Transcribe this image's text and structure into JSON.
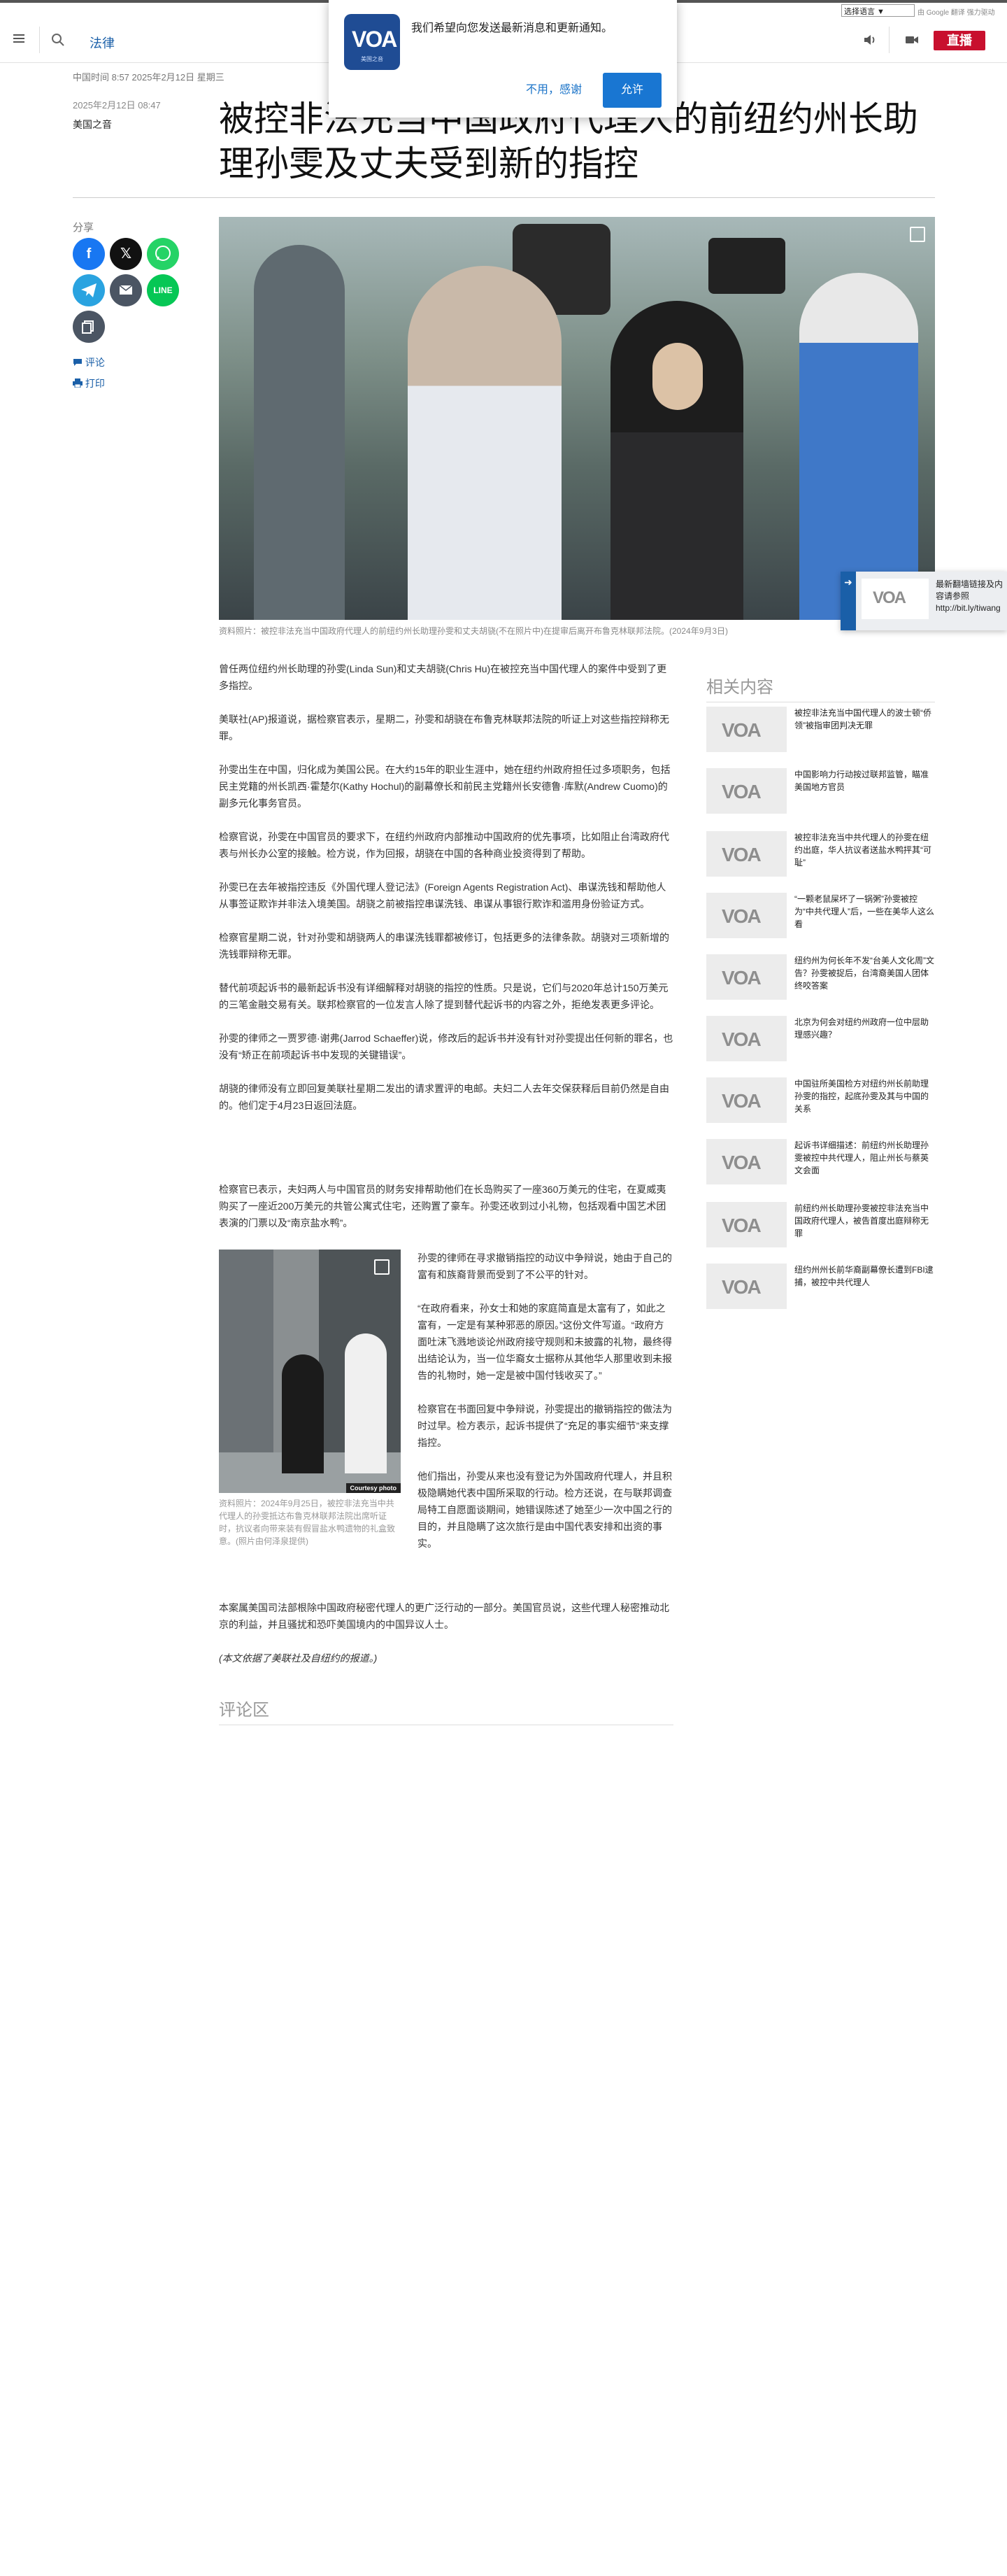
{
  "topbar": {
    "language_select": "选择语言 ▼",
    "google_translate": "由 Google 翻译 强力驱动"
  },
  "header": {
    "section": "法律",
    "live_label": "直播"
  },
  "notification": {
    "message": "我们希望向您发送最新消息和更新通知。",
    "logo_text": "VOA",
    "logo_sub": "美国之音",
    "deny_label": "不用，感谢",
    "allow_label": "允许"
  },
  "article": {
    "dateline": "中国时间 8:57 2025年2月12日 星期三",
    "published": "2025年2月12日 08:47",
    "byline": "美国之音",
    "title": "被控非法充当中国政府代理人的前纽约州长助理孙雯及丈夫受到新的指控",
    "share_label": "分享",
    "comment_link": "评论",
    "print_link": "打印",
    "hero_caption": "资料照片：被控非法充当中国政府代理人的前纽约州长助理孙雯和丈夫胡骁(不在照片中)在提审后离开布鲁克林联邦法院。(2024年9月3日)",
    "paragraphs": [
      "曾任两位纽约州长助理的孙雯(Linda Sun)和丈夫胡骁(Chris Hu)在被控充当中国代理人的案件中受到了更多指控。",
      "美联社(AP)报道说，据检察官表示，星期二，孙雯和胡骁在布鲁克林联邦法院的听证上对这些指控辩称无罪。",
      "孙雯出生在中国，归化成为美国公民。在大约15年的职业生涯中，她在纽约州政府担任过多项职务，包括民主党籍的州长凯西·霍楚尔(Kathy Hochul)的副幕僚长和前民主党籍州长安德鲁·库默(Andrew Cuomo)的副多元化事务官员。",
      "检察官说，孙雯在中国官员的要求下，在纽约州政府内部推动中国政府的优先事项，比如阻止台湾政府代表与州长办公室的接触。检方说，作为回报，胡骁在中国的各种商业投资得到了帮助。",
      "孙雯已在去年被指控违反《外国代理人登记法》(Foreign Agents Registration Act)、串谋洗钱和帮助他人从事签证欺诈并非法入境美国。胡骁之前被指控串谋洗钱、串谋从事银行欺诈和滥用身份验证方式。",
      "检察官星期二说，针对孙雯和胡骁两人的串谋洗钱罪都被修订，包括更多的法律条款。胡骁对三项新增的洗钱罪辩称无罪。",
      "替代前项起诉书的最新起诉书没有详细解释对胡骁的指控的性质。只是说，它们与2020年总计150万美元的三笔金融交易有关。联邦检察官的一位发言人除了提到替代起诉书的内容之外，拒绝发表更多评论。",
      "孙雯的律师之一贾罗德·谢弗(Jarrod Schaeffer)说，修改后的起诉书并没有针对孙雯提出任何新的罪名，也没有“矫正在前项起诉书中发现的关键错误”。",
      "胡骁的律师没有立即回复美联社星期二发出的请求置评的电邮。夫妇二人去年交保获释后目前仍然是自由的。他们定于4月23日返回法庭。"
    ],
    "paragraph_ten": "检察官已表示，夫妇两人与中国官员的财务安排帮助他们在长岛购买了一座360万美元的住宅，在夏威夷购买了一座近200万美元的共管公寓式住宅，还购置了豪车。孙雯还收到过小礼物，包括观看中国艺术团表演的门票以及“南京盐水鸭”。",
    "inline_caption": "资料照片：2024年9月25日，被控非法充当中共代理人的孙雯抵达布鲁克林联邦法院出席听证时，抗议者向带来装有假冒盐水鸭遗物的礼盒致意。(照片由何泽泉提供)",
    "inline_credit": "Courtesy photo",
    "right_paragraphs": [
      "孙雯的律师在寻求撤销指控的动议中争辩说，她由于自己的富有和族裔背景而受到了不公平的针对。",
      "“在政府看来，孙女士和她的家庭简直是太富有了，如此之富有，一定是有某种邪恶的原因。”这份文件写道。“政府方面吐沫飞溅地谈论州政府接守规则和未披露的礼物，最终得出结论认为，当一位华裔女士据称从其他华人那里收到未报告的礼物时，她一定是被中国付钱收买了。”",
      "检察官在书面回复中争辩说，孙雯提出的撤销指控的做法为时过早。检方表示，起诉书提供了“充足的事实细节”来支撑指控。",
      "他们指出，孙雯从来也没有登记为外国政府代理人，并且积极隐瞒她代表中国所采取的行动。检方还说，在与联邦调查局特工自愿面谈期间，她错误陈述了她至少一次中国之行的目的，并且隐瞒了这次旅行是由中国代表安排和出资的事实。"
    ],
    "final_paragraph": "本案属美国司法部根除中国政府秘密代理人的更广泛行动的一部分。美国官员说，这些代理人秘密推动北京的利益，并且骚扰和恐吓美国境内的中国异议人士。",
    "source_note": "(本文依据了美联社及自纽约的报道。)",
    "comments_heading": "评论区"
  },
  "related": {
    "heading": "相关内容",
    "thumb_label": "VOA",
    "items": [
      "被控非法充当中国代理人的波士顿“侨领”被指审团判决无罪",
      "中国影响力行动按过联邦监管，瞄准美国地方官员",
      "被控非法充当中共代理人的孙雯在纽约出庭，华人抗议者送盐水鸭抨其“可耻”",
      "“一颗老鼠屎坏了一锅粥”孙雯被控为“中共代理人”后，一些在美华人这么看",
      "纽约州为何长年不发“台美人文化周”文告？孙雯被捉后，台湾裔美国人团体终咬答案",
      "北京为何会对纽约州政府一位中层助理感兴趣？",
      "中国驻所美国检方对纽约州长前助理孙雯的指控，起底孙雯及其与中国的关系",
      "起诉书详细描述：前纽约州长助理孙雯被控中共代理人，阻止州长与蔡英文会面",
      "前纽约州长助理孙雯被控非法充当中国政府代理人，被告首度出庭辩称无罪",
      "纽约州州长前华裔副幕僚长遭到FBI逮捕，被控中共代理人"
    ]
  },
  "sticky": {
    "thumb_label": "VOA",
    "text": "最新翻墙链接及内容请参照 http://bit.ly/tiwang"
  }
}
